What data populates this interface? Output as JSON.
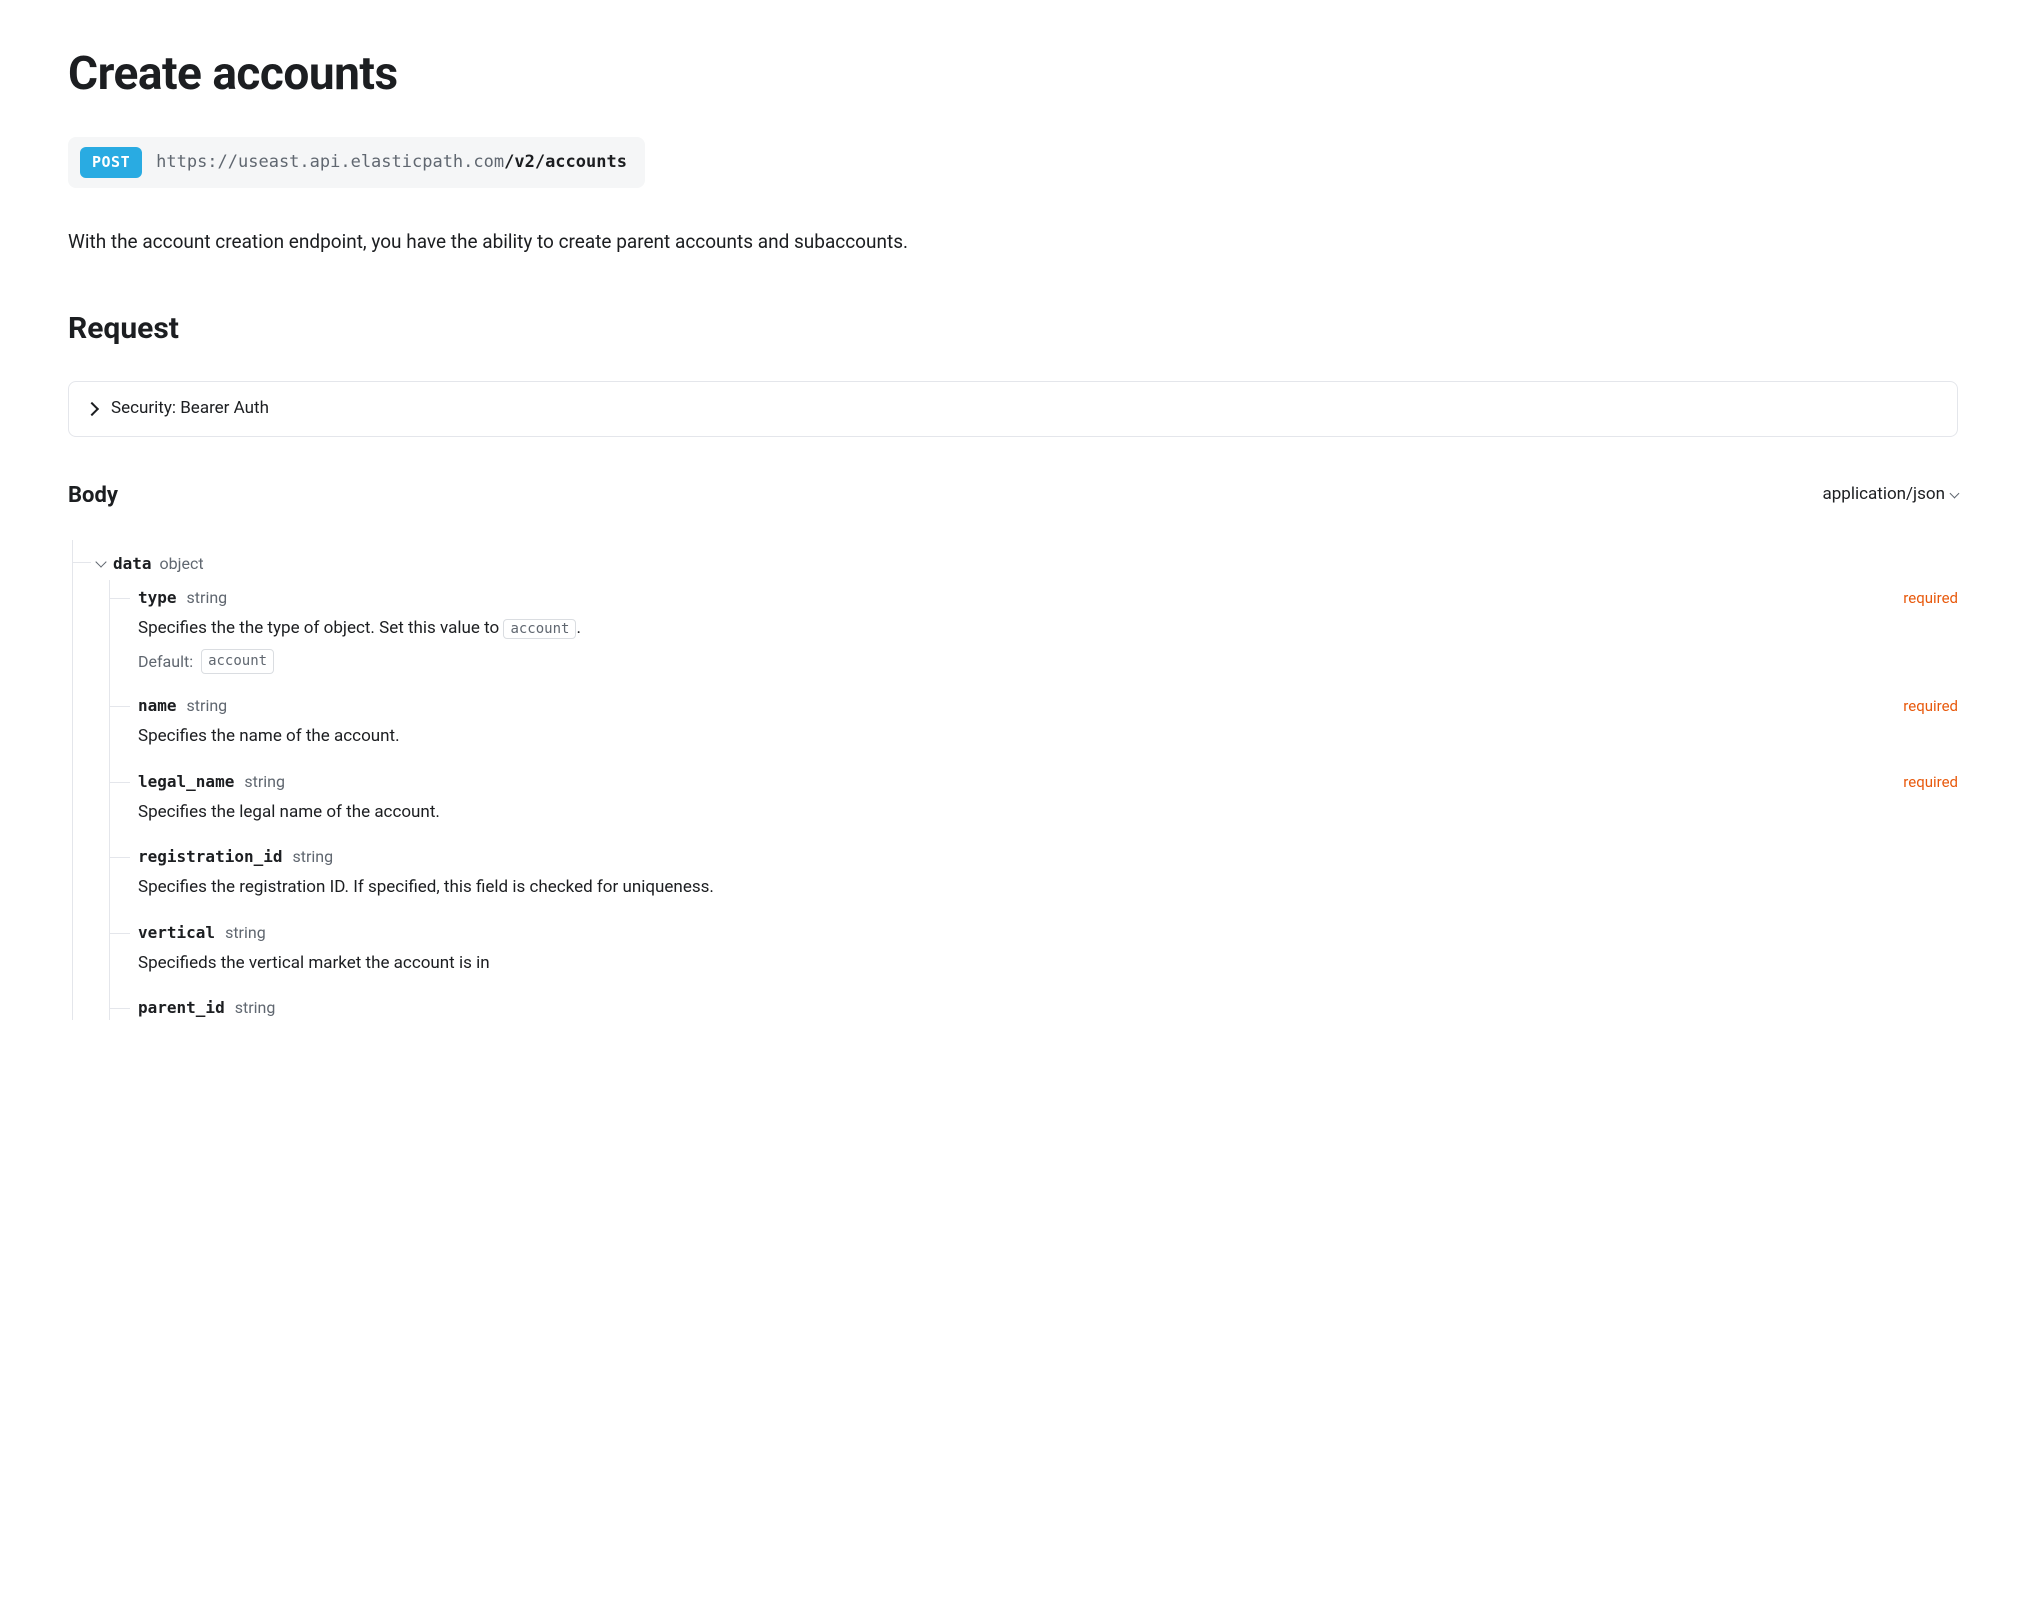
{
  "title": "Create accounts",
  "endpoint": {
    "method": "POST",
    "base": "https://useast.api.elasticpath.com",
    "path": "/v2/accounts"
  },
  "description": "With the account creation endpoint, you have the ability to create parent accounts and subaccounts.",
  "request": {
    "heading": "Request",
    "security_label": "Security: Bearer Auth",
    "body_heading": "Body",
    "content_type": "application/json",
    "root": {
      "name": "data",
      "type": "object"
    },
    "required_label": "required",
    "default_label": "Default:",
    "fields": [
      {
        "name": "type",
        "type": "string",
        "required": true,
        "desc_pre": "Specifies the the type of object. Set this value to ",
        "desc_code": "account",
        "desc_post": ".",
        "default": "account"
      },
      {
        "name": "name",
        "type": "string",
        "required": true,
        "desc": "Specifies the name of the account."
      },
      {
        "name": "legal_name",
        "type": "string",
        "required": true,
        "desc": "Specifies the legal name of the account."
      },
      {
        "name": "registration_id",
        "type": "string",
        "required": false,
        "desc": "Specifies the registration ID. If specified, this field is checked for uniqueness."
      },
      {
        "name": "vertical",
        "type": "string",
        "required": false,
        "desc": "Specifieds the vertical market the account is in"
      },
      {
        "name": "parent_id",
        "type": "string",
        "required": false
      }
    ]
  }
}
